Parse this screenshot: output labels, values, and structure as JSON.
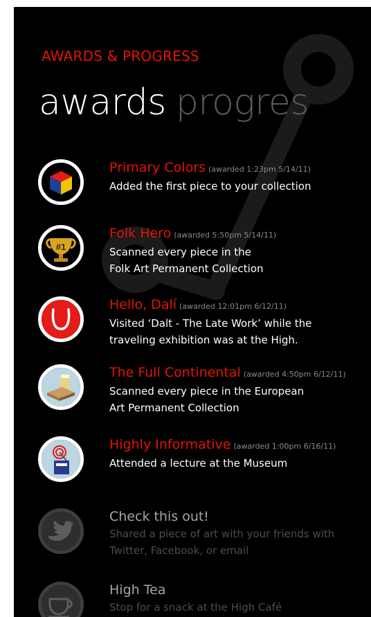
{
  "app": {
    "title": "AWARDS & PROGRESS"
  },
  "pivot": {
    "active": "awards",
    "next": "progres"
  },
  "colors": {
    "accent": "#e51400",
    "background": "#000000",
    "locked": "#3e3e3e"
  },
  "awards": [
    {
      "title": "Primary Colors",
      "date": "(awarded 1:23pm 5/14/11)",
      "desc": [
        "Added the first piece to your collection"
      ],
      "icon": "primary-colors-cube-icon",
      "unlocked": true
    },
    {
      "title": "Folk Hero",
      "date": "(awarded 5:50pm 5/14/11)",
      "desc": [
        "Scanned every piece in the",
        "Folk Art Permanent Collection"
      ],
      "icon": "trophy-number-one-icon",
      "unlocked": true
    },
    {
      "title": "Hello, Dalí",
      "date": "(awarded 12:01pm 6/12/11)",
      "desc": [
        "Visited ‘Dalt - The Late Work’ while the",
        "traveling exhibition was at the High."
      ],
      "icon": "dali-mustache-icon",
      "unlocked": true
    },
    {
      "title": "The Full Continental",
      "date": "(awarded 4:50pm 6/12/11)",
      "desc": [
        "Scanned every piece in the European",
        "Art Permanent Collection"
      ],
      "icon": "continental-breakfast-icon",
      "unlocked": true
    },
    {
      "title": "Highly Informative",
      "date": "(awarded 1:00pm 6/16/11)",
      "desc": [
        "Attended a lecture at the Museum"
      ],
      "icon": "lecture-podium-icon",
      "unlocked": true
    },
    {
      "title": "Check this out!",
      "date": "",
      "desc": [
        "Shared a piece of art with your friends with",
        "Twitter, Facebook, or email"
      ],
      "icon": "twitter-bird-icon",
      "unlocked": false
    },
    {
      "title": "High Tea",
      "date": "",
      "desc": [
        "Stop for a snack at the High Café"
      ],
      "icon": "teacup-icon",
      "unlocked": false
    }
  ]
}
